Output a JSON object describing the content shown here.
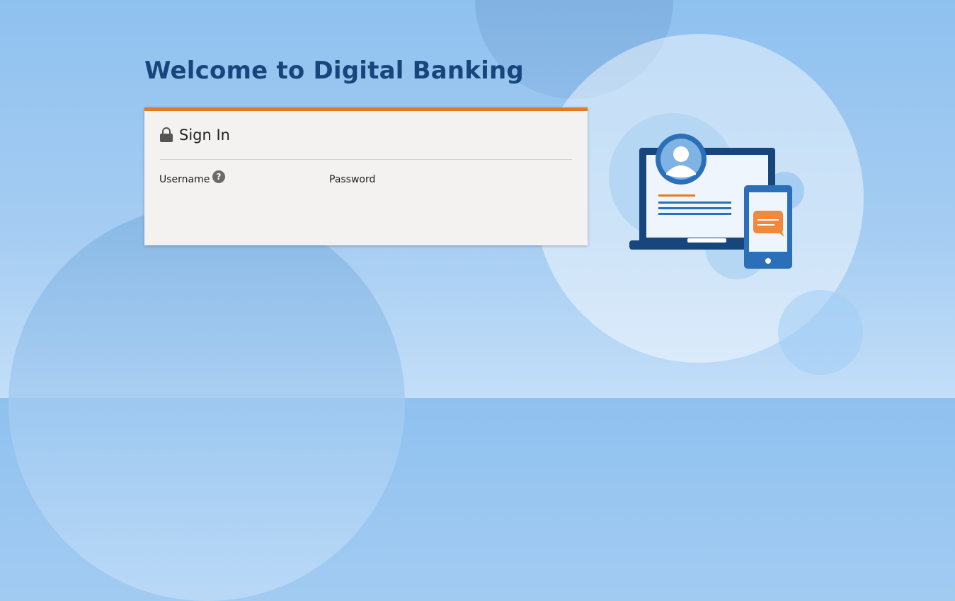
{
  "page": {
    "heading": "Welcome to Digital Banking"
  },
  "signin": {
    "title": "Sign In",
    "username_label": "Username",
    "password_label": "Password",
    "help_glyph": "?"
  },
  "icons": {
    "lock": "lock-icon",
    "help": "help-icon",
    "illustration": "laptop-and-phone-illustration"
  },
  "colors": {
    "heading": "#16467c",
    "accent": "#e47a1e",
    "card_bg": "#f3f2f1",
    "background": "#a6cdf2"
  }
}
